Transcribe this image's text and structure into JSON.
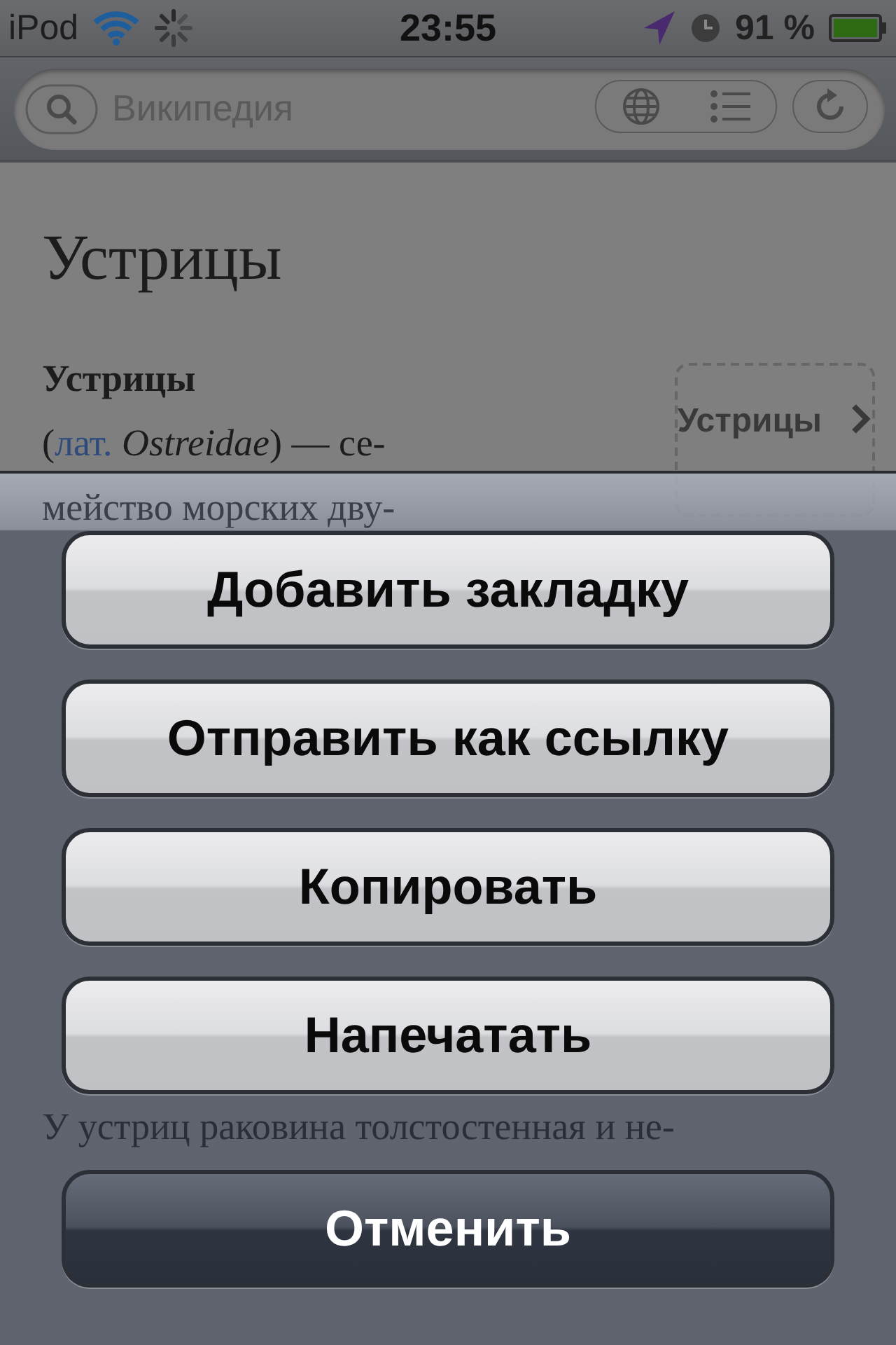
{
  "status_bar": {
    "carrier": "iPod",
    "time": "23:55",
    "battery_text": "91 %"
  },
  "address_bar": {
    "placeholder": "Википедия"
  },
  "article": {
    "title": "Устрицы",
    "lead_term": "Устрицы",
    "intro": {
      "open": "(",
      "link": "лат.",
      "rest": " *Ostreidae*) — се-"
    },
    "infobox_link": "Устрицы",
    "lines_behind_sheet": [
      "мейство морских дву-",
      "У устриц раковина толстостенная и не-"
    ]
  },
  "action_sheet": {
    "buttons": [
      {
        "label": "Добавить закладку",
        "kind": "default"
      },
      {
        "label": "Отправить как ссылку",
        "kind": "default"
      },
      {
        "label": "Копировать",
        "kind": "default"
      },
      {
        "label": "Напечатать",
        "kind": "default"
      },
      {
        "label": "Отменить",
        "kind": "cancel"
      }
    ]
  }
}
